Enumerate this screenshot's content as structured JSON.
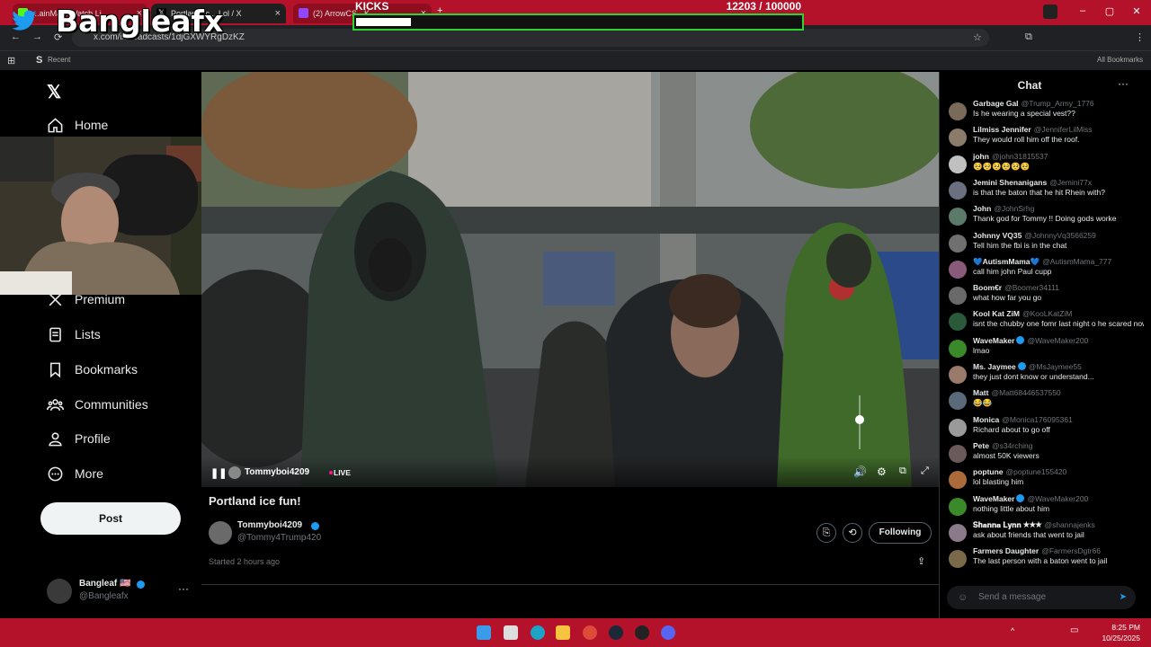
{
  "browser": {
    "tabs": [
      {
        "title": "...ainMa... Watch Li..."
      },
      {
        "title": "Portland Ic... Lol / X"
      },
      {
        "title": "(2) ArrowCS - K..."
      }
    ],
    "url": "x.com/i/broadcasts/1djGXWYRgDzKZ",
    "bookmark_recent": "Recent",
    "bookmark_all": "All Bookmarks"
  },
  "overlay": {
    "streamer_logo": "Bangleafx",
    "kicks_label": "KICKS",
    "kicks_count": "12203  / 100000",
    "kicks_progress": 0.122
  },
  "nav": {
    "home": "Home",
    "premium": "Premium",
    "lists": "Lists",
    "bookmarks": "Bookmarks",
    "communities": "Communities",
    "profile": "Profile",
    "more": "More",
    "post": "Post"
  },
  "account": {
    "name": "Bangleaf 🇺🇸",
    "handle": "@Bangleafx"
  },
  "video": {
    "host": "Tommyboi4209",
    "live": "LIVE",
    "volume_level": 0.55
  },
  "broadcast": {
    "title": "Portland ice fun!",
    "host_name": "Tommyboi4209",
    "host_handle": "@Tommy4Trump420",
    "started": "Started 2 hours ago",
    "follow_label": "Following"
  },
  "chat": {
    "title": "Chat",
    "placeholder": "Send a message",
    "messages": [
      {
        "name": "Garbage Gal",
        "handle": "@Trump_Army_1776",
        "text": "Is he wearing a special vest??",
        "verified": false,
        "color": "#7a6a5a"
      },
      {
        "name": "Lilmiss Jennifer",
        "handle": "@JenniferLilMiss",
        "text": "They would roll him off the roof.",
        "verified": false,
        "color": "#8a7b6b"
      },
      {
        "name": "john",
        "handle": "@john31815537",
        "text": "🥺🥺🥺🥺🥺🥺",
        "verified": false,
        "color": "#c0c0c0"
      },
      {
        "name": "Jemini Shenanigans",
        "handle": "@Jemini77x",
        "text": "is that the baton that he hit Rhein with?",
        "verified": false,
        "color": "#6a7080"
      },
      {
        "name": "John",
        "handle": "@JohnSrhg",
        "text": "Thank god for Tommy !! Doing gods worke",
        "verified": false,
        "color": "#5b7a6a"
      },
      {
        "name": "Johnny VQ35",
        "handle": "@JohnnyVq3566259",
        "text": "Tell him the fbi is in the chat",
        "verified": false,
        "color": "#707070"
      },
      {
        "name": "💙AutismMama💙",
        "handle": "@AutismMama_777",
        "text": "call him john Paul cupp",
        "verified": false,
        "color": "#8a5a7a"
      },
      {
        "name": "Boom€r",
        "handle": "@Boomer34111",
        "text": "what how far you go",
        "verified": false,
        "color": "#6a6a6a"
      },
      {
        "name": "Kool Kat ZiM",
        "handle": "@KooLKatZiM",
        "text": "isnt the chubby one fomr last night o he scared now he brought a baton",
        "verified": false,
        "color": "#2a5a3a"
      },
      {
        "name": "WaveMaker",
        "handle": "@WaveMaker200",
        "text": "lmao",
        "verified": true,
        "color": "#3a8a2a"
      },
      {
        "name": "Ms. Jaymee",
        "handle": "@MsJaymee55",
        "text": "they just dont know or understand...",
        "verified": true,
        "color": "#9a7a6a"
      },
      {
        "name": "Matt",
        "handle": "@Matt68446537550",
        "text": "😂😂",
        "verified": false,
        "color": "#5a6a7a"
      },
      {
        "name": "Monica",
        "handle": "@Monica176095361",
        "text": "Richard about to go off",
        "verified": false,
        "color": "#9a9a9a"
      },
      {
        "name": "Pete",
        "handle": "@s34rching",
        "text": "almost 50K viewers",
        "verified": false,
        "color": "#6a5a5a"
      },
      {
        "name": "poptune",
        "handle": "@poptune155420",
        "text": "lol blasting him",
        "verified": false,
        "color": "#aa6a3a"
      },
      {
        "name": "WaveMaker",
        "handle": "@WaveMaker200",
        "text": "nothing little about him",
        "verified": true,
        "color": "#3a8a2a"
      },
      {
        "name": "𝐒𝐡𝐚𝐧𝐧𝐚 𝐋𝐲𝐧𝐧 ★★★",
        "handle": "@shannajenks",
        "text": "ask about friends that went to jail",
        "verified": false,
        "color": "#8a7a8a"
      },
      {
        "name": "Farmers Daughter",
        "handle": "@FarmersDgtr66",
        "text": "The last person with a baton went to jail",
        "verified": false,
        "color": "#7a6a4a"
      }
    ]
  },
  "taskbar": {
    "time": "8:25 PM",
    "date": "10/25/2025"
  }
}
